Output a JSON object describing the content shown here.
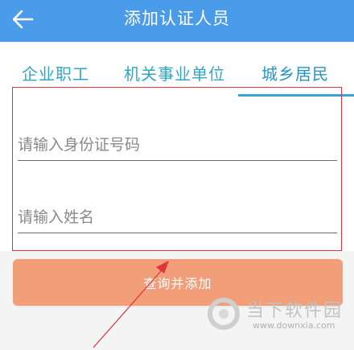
{
  "header": {
    "title": "添加认证人员",
    "back_icon": "arrow-left-icon",
    "bg_color": "#4a9bea"
  },
  "tabs": [
    {
      "label": "企业职工",
      "selected": false
    },
    {
      "label": "机关事业单位",
      "selected": false
    },
    {
      "label": "城乡居民",
      "selected": true
    }
  ],
  "form": {
    "id_number": {
      "value": "",
      "placeholder": "请输入身份证号码"
    },
    "name": {
      "value": "",
      "placeholder": "请输入姓名"
    }
  },
  "submit": {
    "label": "查询并添加",
    "color": "#f19e79"
  },
  "annotation": {
    "highlight_color": "#e0333a"
  },
  "watermark": {
    "name": "当下软件园",
    "url": "www.downxia.com"
  }
}
